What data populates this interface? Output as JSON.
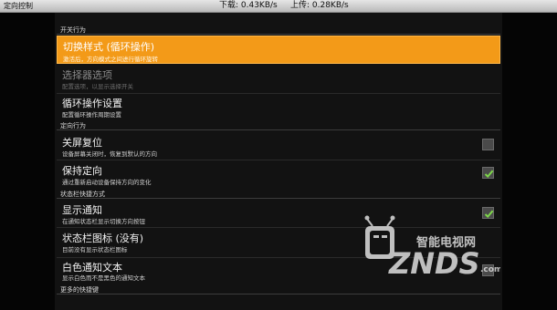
{
  "window": {
    "title": "定向控制",
    "download": "下载: 0.43KB/s",
    "upload": "上传: 0.28KB/s"
  },
  "sections": {
    "switch_behavior": "开关行为",
    "orientation_behavior": "定向行为",
    "statusbar_shortcut": "状态栏快捷方式",
    "more_shortcuts": "更多的快捷键"
  },
  "items": {
    "switch_style": {
      "title": "切换样式 (循环操作)",
      "summary": "激活后，方向模式之间进行循环旋转"
    },
    "selector_options": {
      "title": "选择器选项",
      "summary": "配置选项，以显示选择开关"
    },
    "cycle_settings": {
      "title": "循环操作设置",
      "summary": "配置循环操作周期设置"
    },
    "reset_on_screen_off": {
      "title": "关屏复位",
      "summary": "设备屏幕关闭时，恢复到默认的方向",
      "checked": false
    },
    "keep_orientation": {
      "title": "保持定向",
      "summary": "通过重新启动设备保持方向的变化",
      "checked": true
    },
    "show_notification": {
      "title": "显示通知",
      "summary": "在通知状态栏显示切换方向按钮",
      "checked": true
    },
    "statusbar_icon": {
      "title": "状态栏图标 (没有)",
      "summary": "目前没有显示状态栏图标"
    },
    "white_notification_text": {
      "title": "白色通知文本",
      "summary": "显示白色而不是黑色的通知文本",
      "checked": false
    }
  },
  "watermark": {
    "line1": "智能电视网",
    "line2": "ZNDS",
    "suffix": ".com"
  },
  "colors": {
    "accent": "#f39a18",
    "check": "#7ed84a",
    "background": "#121212"
  }
}
